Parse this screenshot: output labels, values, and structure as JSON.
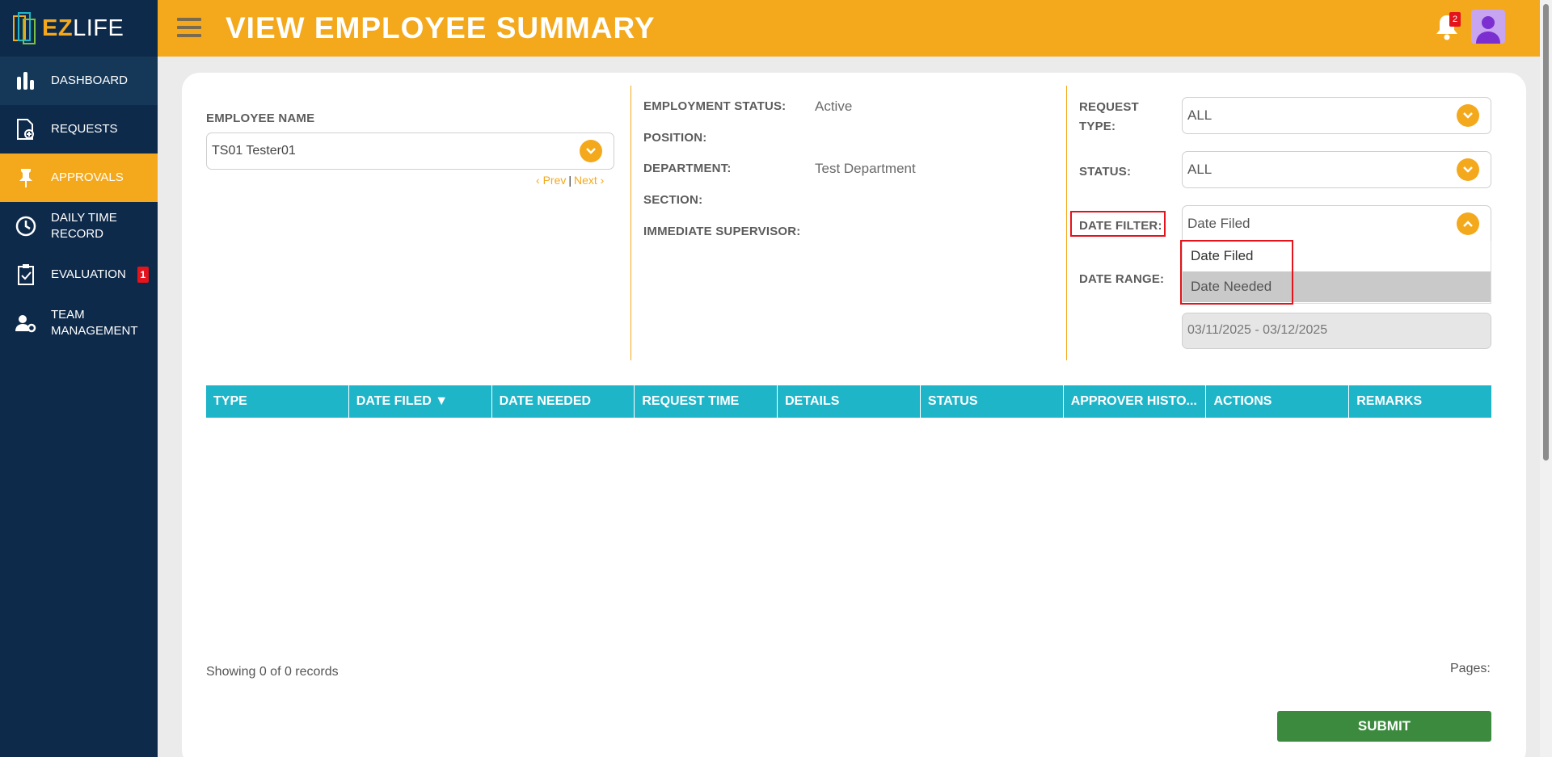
{
  "app": {
    "logo_ez": "EZ",
    "logo_life": "LIFE",
    "page_title": "VIEW EMPLOYEE SUMMARY",
    "notification_count": "2",
    "accent_color": "#f4a91c",
    "sidebar_color": "#0e2a4a"
  },
  "sidebar": {
    "items": [
      {
        "label": "DASHBOARD",
        "icon": "bar-chart-icon"
      },
      {
        "label": "REQUESTS",
        "icon": "request-doc-icon"
      },
      {
        "label": "APPROVALS",
        "icon": "pin-icon",
        "active": true
      },
      {
        "label": "DAILY TIME RECORD",
        "icon": "clock-icon"
      },
      {
        "label": "EVALUATION",
        "icon": "checklist-icon",
        "badge": "1"
      },
      {
        "label": "TEAM MANAGEMENT",
        "icon": "user-gear-icon"
      }
    ]
  },
  "employee": {
    "name_label": "EMPLOYEE NAME",
    "name_value": "TS01 Tester01",
    "prev": "Prev",
    "separator": "|",
    "next": "Next"
  },
  "details": {
    "employment_status_label": "EMPLOYMENT STATUS:",
    "employment_status_value": "Active",
    "position_label": "POSITION:",
    "position_value": "",
    "department_label": "DEPARTMENT:",
    "department_value": "Test Department",
    "section_label": "SECTION:",
    "section_value": "",
    "supervisor_label": "IMMEDIATE SUPERVISOR:",
    "supervisor_value": ""
  },
  "filters": {
    "request_type_label_1": "REQUEST",
    "request_type_label_2": "TYPE:",
    "request_type_value": "ALL",
    "status_label": "STATUS:",
    "status_value": "ALL",
    "date_filter_label": "DATE FILTER:",
    "date_filter_value": "Date Filed",
    "date_filter_options": [
      "Date Filed",
      "Date Needed"
    ],
    "date_range_label": "DATE RANGE:",
    "date_range_value": "03/11/2025 - 03/12/2025"
  },
  "table": {
    "columns": [
      "TYPE",
      "DATE FILED ▼",
      "DATE NEEDED",
      "REQUEST TIME",
      "DETAILS",
      "STATUS",
      "APPROVER HISTO...",
      "ACTIONS",
      "REMARKS"
    ],
    "rows": []
  },
  "footer": {
    "showing": "Showing 0 of 0 records",
    "pages_label": "Pages:",
    "submit_label": "SUBMIT"
  }
}
